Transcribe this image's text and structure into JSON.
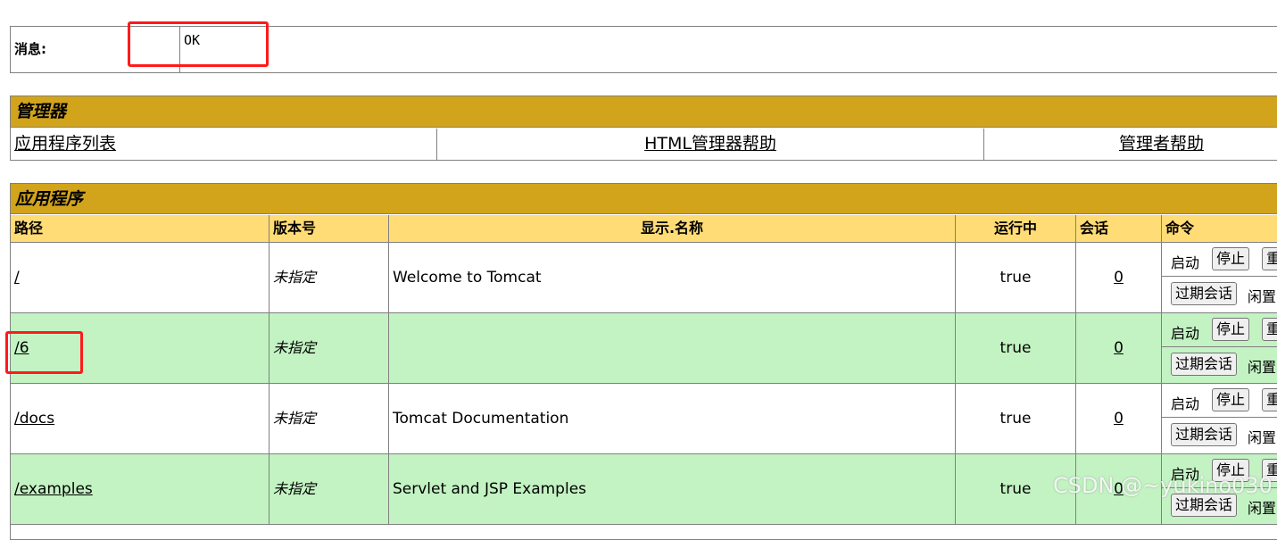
{
  "message": {
    "label": "消息:",
    "value": "OK"
  },
  "manager": {
    "title": "管理器",
    "links": [
      "应用程序列表",
      "HTML管理器帮助",
      "管理者帮助"
    ]
  },
  "applications": {
    "title": "应用程序",
    "headers": {
      "path": "路径",
      "version": "版本号",
      "display_name": "显示.名称",
      "running": "运行中",
      "sessions": "会话",
      "commands": "命令"
    },
    "rows": [
      {
        "path": "/",
        "version": "未指定",
        "display_name": "Welcome to Tomcat",
        "running": "true",
        "sessions": "0"
      },
      {
        "path": "/6",
        "version": "未指定",
        "display_name": "",
        "running": "true",
        "sessions": "0"
      },
      {
        "path": "/docs",
        "version": "未指定",
        "display_name": "Tomcat Documentation",
        "running": "true",
        "sessions": "0"
      },
      {
        "path": "/examples",
        "version": "未指定",
        "display_name": "Servlet and JSP Examples",
        "running": "true",
        "sessions": "0"
      }
    ],
    "commands": {
      "start": "启动",
      "stop": "停止",
      "reload_partial": "重",
      "expire_sessions": "过期会话",
      "idle": "闲置"
    }
  },
  "watermark": "CSDN @~yukino030",
  "colors": {
    "title_bar": "#d2a41c",
    "header_row": "#ffdc75",
    "alt_row": "#c3f3c3",
    "highlight": "#ff1a1a"
  }
}
